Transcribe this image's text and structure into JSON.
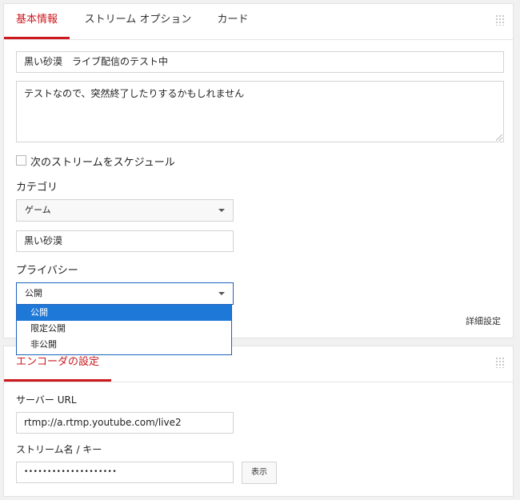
{
  "tabs": {
    "basic": "基本情報",
    "stream_options": "ストリーム オプション",
    "card": "カード"
  },
  "basic": {
    "title_value": "黒い砂漠　ライブ配信のテスト中",
    "description_value": "テストなので、突然終了したりするかもしれません",
    "schedule_label": "次のストリームをスケジュール",
    "category_label": "カテゴリ",
    "category_selected": "ゲーム",
    "game_title_value": "黒い砂漠",
    "privacy_label": "プライバシー",
    "privacy_selected": "公開",
    "privacy_options": [
      "公開",
      "限定公開",
      "非公開"
    ],
    "advanced_link": "詳細設定"
  },
  "encoder": {
    "tab_label": "エンコーダの設定",
    "server_label": "サーバー URL",
    "server_value": "rtmp://a.rtmp.youtube.com/live2",
    "key_label": "ストリーム名 / キー",
    "key_value": "••••••••••••••••••••",
    "show_button": "表示"
  },
  "colors": {
    "accent": "#cc181e",
    "selection": "#1e78d7",
    "focus_border": "#1c62b9"
  }
}
